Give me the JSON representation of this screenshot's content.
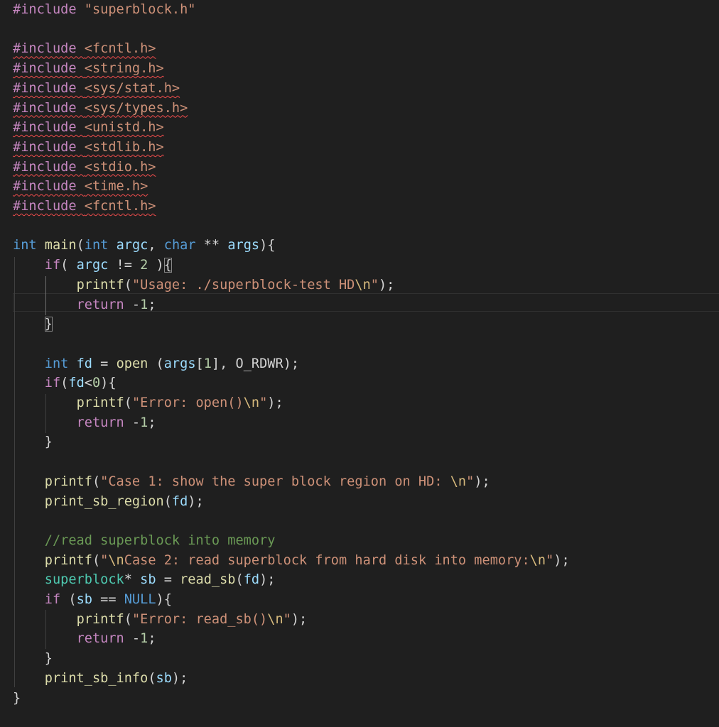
{
  "editor": {
    "theme": "dark",
    "colors": {
      "background": "#1f1f1f",
      "preprocessor": "#c586c0",
      "string": "#ce9178",
      "keyword": "#569cd6",
      "control": "#c586c0",
      "function": "#dcdcaa",
      "variable": "#9cdcfe",
      "number": "#b5cea8",
      "type": "#4ec9b0",
      "comment": "#6a9955",
      "escape": "#d7ba7d",
      "error_squiggle": "#f14c4c"
    },
    "lines": [
      {
        "row": 0,
        "tokens": [
          [
            "pre",
            "#include "
          ],
          [
            "str",
            "\"superblock.h\""
          ]
        ]
      },
      {
        "row": 1,
        "tokens": []
      },
      {
        "row": 2,
        "squiggle": true,
        "tokens": [
          [
            "pre",
            "#include "
          ],
          [
            "hdr",
            "<fcntl.h>"
          ]
        ]
      },
      {
        "row": 3,
        "squiggle": true,
        "tokens": [
          [
            "pre",
            "#include "
          ],
          [
            "hdr",
            "<string.h>"
          ]
        ]
      },
      {
        "row": 4,
        "squiggle": true,
        "tokens": [
          [
            "pre",
            "#include "
          ],
          [
            "hdr",
            "<sys/stat.h>"
          ]
        ]
      },
      {
        "row": 5,
        "squiggle": true,
        "tokens": [
          [
            "pre",
            "#include "
          ],
          [
            "hdr",
            "<sys/types.h>"
          ]
        ]
      },
      {
        "row": 6,
        "squiggle": true,
        "tokens": [
          [
            "pre",
            "#include "
          ],
          [
            "hdr",
            "<unistd.h>"
          ]
        ]
      },
      {
        "row": 7,
        "squiggle": true,
        "tokens": [
          [
            "pre",
            "#include "
          ],
          [
            "hdr",
            "<stdlib.h>"
          ]
        ]
      },
      {
        "row": 8,
        "squiggle": true,
        "tokens": [
          [
            "pre",
            "#include "
          ],
          [
            "hdr",
            "<stdio.h>"
          ]
        ]
      },
      {
        "row": 9,
        "squiggle": true,
        "tokens": [
          [
            "pre",
            "#include "
          ],
          [
            "hdr",
            "<time.h>"
          ]
        ]
      },
      {
        "row": 10,
        "squiggle": true,
        "tokens": [
          [
            "pre",
            "#include "
          ],
          [
            "hdr",
            "<fcntl.h>"
          ]
        ]
      },
      {
        "row": 11,
        "tokens": []
      },
      {
        "row": 12,
        "tokens": [
          [
            "kw",
            "int"
          ],
          [
            "plain",
            " "
          ],
          [
            "fn",
            "main"
          ],
          [
            "plain",
            "("
          ],
          [
            "kw",
            "int"
          ],
          [
            "plain",
            " "
          ],
          [
            "var",
            "argc"
          ],
          [
            "plain",
            ", "
          ],
          [
            "kw",
            "char"
          ],
          [
            "plain",
            " ** "
          ],
          [
            "var",
            "args"
          ],
          [
            "plain",
            "){"
          ]
        ]
      },
      {
        "row": 13,
        "tokens": [
          [
            "plain",
            "    "
          ],
          [
            "ctl",
            "if"
          ],
          [
            "plain",
            "( "
          ],
          [
            "var",
            "argc"
          ],
          [
            "plain",
            " != "
          ],
          [
            "num",
            "2"
          ],
          [
            "plain",
            " )"
          ],
          [
            "box",
            "{"
          ]
        ]
      },
      {
        "row": 14,
        "tokens": [
          [
            "plain",
            "        "
          ],
          [
            "fn",
            "printf"
          ],
          [
            "plain",
            "("
          ],
          [
            "str",
            "\"Usage: ./superblock-test HD"
          ],
          [
            "esc",
            "\\n"
          ],
          [
            "str",
            "\""
          ],
          [
            "plain",
            ");"
          ]
        ]
      },
      {
        "row": 15,
        "tokens": [
          [
            "plain",
            "        "
          ],
          [
            "ctl",
            "return"
          ],
          [
            "plain",
            " -"
          ],
          [
            "num",
            "1"
          ],
          [
            "plain",
            ";"
          ]
        ]
      },
      {
        "row": 16,
        "tokens": [
          [
            "plain",
            "    "
          ],
          [
            "box",
            "}"
          ]
        ]
      },
      {
        "row": 17,
        "tokens": []
      },
      {
        "row": 18,
        "tokens": [
          [
            "plain",
            "    "
          ],
          [
            "kw",
            "int"
          ],
          [
            "plain",
            " "
          ],
          [
            "var",
            "fd"
          ],
          [
            "plain",
            " = "
          ],
          [
            "fn",
            "open"
          ],
          [
            "plain",
            " ("
          ],
          [
            "var",
            "args"
          ],
          [
            "plain",
            "["
          ],
          [
            "num",
            "1"
          ],
          [
            "plain",
            "], "
          ],
          [
            "plain",
            "O_RDWR"
          ],
          [
            "plain",
            ");"
          ]
        ]
      },
      {
        "row": 19,
        "tokens": [
          [
            "plain",
            "    "
          ],
          [
            "ctl",
            "if"
          ],
          [
            "plain",
            "("
          ],
          [
            "var",
            "fd"
          ],
          [
            "plain",
            "<"
          ],
          [
            "num",
            "0"
          ],
          [
            "plain",
            "){"
          ]
        ]
      },
      {
        "row": 20,
        "tokens": [
          [
            "plain",
            "        "
          ],
          [
            "fn",
            "printf"
          ],
          [
            "plain",
            "("
          ],
          [
            "str",
            "\"Error: open()"
          ],
          [
            "esc",
            "\\n"
          ],
          [
            "str",
            "\""
          ],
          [
            "plain",
            ");"
          ]
        ]
      },
      {
        "row": 21,
        "tokens": [
          [
            "plain",
            "        "
          ],
          [
            "ctl",
            "return"
          ],
          [
            "plain",
            " -"
          ],
          [
            "num",
            "1"
          ],
          [
            "plain",
            ";"
          ]
        ]
      },
      {
        "row": 22,
        "tokens": [
          [
            "plain",
            "    }"
          ]
        ]
      },
      {
        "row": 23,
        "tokens": []
      },
      {
        "row": 24,
        "tokens": [
          [
            "plain",
            "    "
          ],
          [
            "fn",
            "printf"
          ],
          [
            "plain",
            "("
          ],
          [
            "str",
            "\"Case 1: show the super block region on HD: "
          ],
          [
            "esc",
            "\\n"
          ],
          [
            "str",
            "\""
          ],
          [
            "plain",
            ");"
          ]
        ]
      },
      {
        "row": 25,
        "tokens": [
          [
            "plain",
            "    "
          ],
          [
            "fn",
            "print_sb_region"
          ],
          [
            "plain",
            "("
          ],
          [
            "var",
            "fd"
          ],
          [
            "plain",
            ");"
          ]
        ]
      },
      {
        "row": 26,
        "tokens": []
      },
      {
        "row": 27,
        "tokens": [
          [
            "plain",
            "    "
          ],
          [
            "cmt",
            "//read superblock into memory"
          ]
        ]
      },
      {
        "row": 28,
        "tokens": [
          [
            "plain",
            "    "
          ],
          [
            "fn",
            "printf"
          ],
          [
            "plain",
            "("
          ],
          [
            "str",
            "\""
          ],
          [
            "esc",
            "\\n"
          ],
          [
            "str",
            "Case 2: read superblock from hard disk into memory:"
          ],
          [
            "esc",
            "\\n"
          ],
          [
            "str",
            "\""
          ],
          [
            "plain",
            ");"
          ]
        ]
      },
      {
        "row": 29,
        "tokens": [
          [
            "plain",
            "    "
          ],
          [
            "type",
            "superblock"
          ],
          [
            "plain",
            "* "
          ],
          [
            "var",
            "sb"
          ],
          [
            "plain",
            " = "
          ],
          [
            "fn",
            "read_sb"
          ],
          [
            "plain",
            "("
          ],
          [
            "var",
            "fd"
          ],
          [
            "plain",
            ");"
          ]
        ]
      },
      {
        "row": 30,
        "tokens": [
          [
            "plain",
            "    "
          ],
          [
            "ctl",
            "if"
          ],
          [
            "plain",
            " ("
          ],
          [
            "var",
            "sb"
          ],
          [
            "plain",
            " == "
          ],
          [
            "kw",
            "NULL"
          ],
          [
            "plain",
            "){"
          ]
        ]
      },
      {
        "row": 31,
        "tokens": [
          [
            "plain",
            "        "
          ],
          [
            "fn",
            "printf"
          ],
          [
            "plain",
            "("
          ],
          [
            "str",
            "\"Error: read_sb()"
          ],
          [
            "esc",
            "\\n"
          ],
          [
            "str",
            "\""
          ],
          [
            "plain",
            ");"
          ]
        ]
      },
      {
        "row": 32,
        "tokens": [
          [
            "plain",
            "        "
          ],
          [
            "ctl",
            "return"
          ],
          [
            "plain",
            " -"
          ],
          [
            "num",
            "1"
          ],
          [
            "plain",
            ";"
          ]
        ]
      },
      {
        "row": 33,
        "tokens": [
          [
            "plain",
            "    }"
          ]
        ]
      },
      {
        "row": 34,
        "tokens": [
          [
            "plain",
            "    "
          ],
          [
            "fn",
            "print_sb_info"
          ],
          [
            "plain",
            "("
          ],
          [
            "var",
            "sb"
          ],
          [
            "plain",
            ");"
          ]
        ]
      },
      {
        "row": 35,
        "tokens": [
          [
            "plain",
            "}"
          ]
        ]
      }
    ]
  }
}
